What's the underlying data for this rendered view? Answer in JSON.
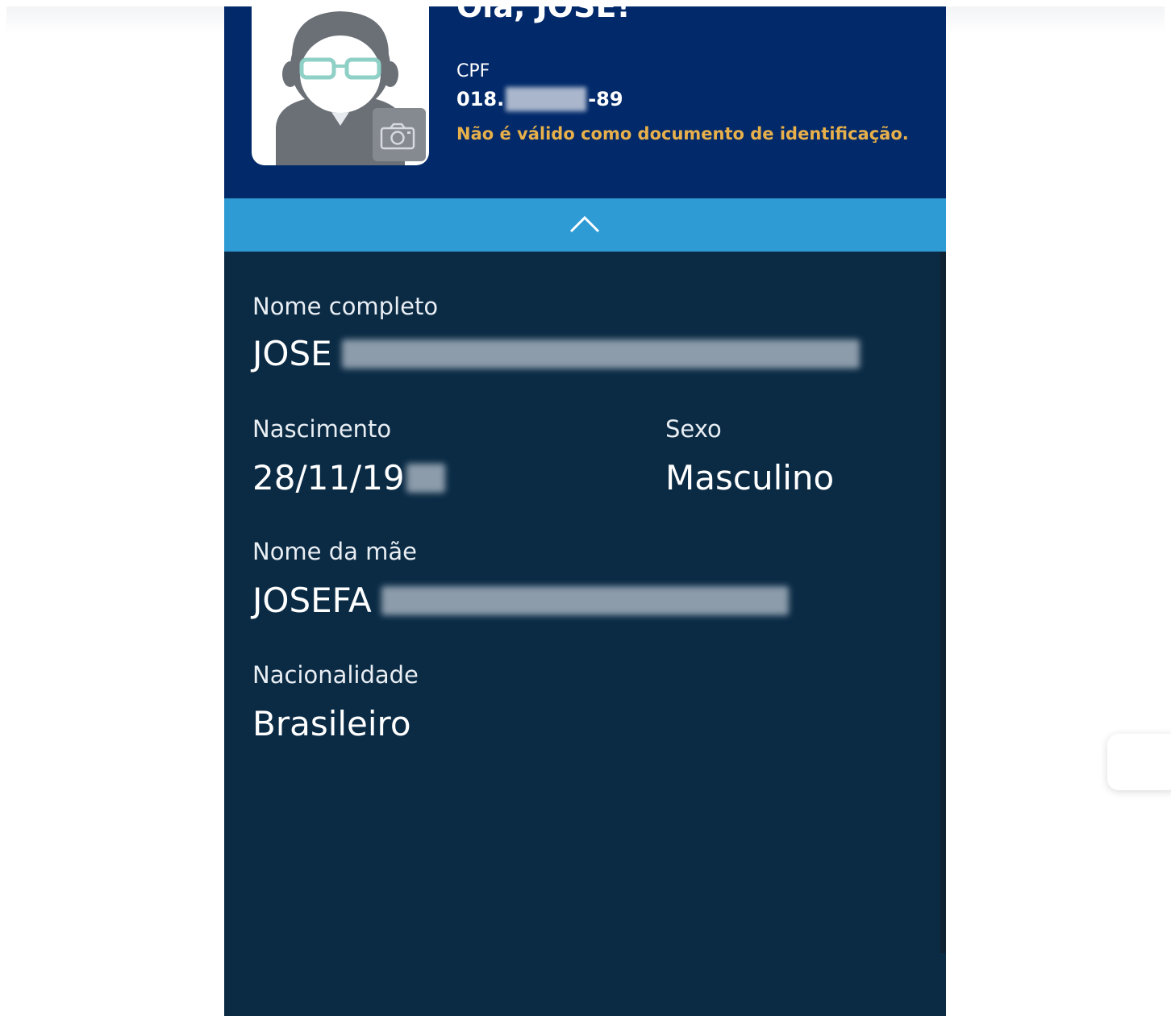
{
  "header": {
    "greeting": "Olá, JOSE!",
    "cpf_label": "CPF",
    "cpf_prefix": "018.",
    "cpf_suffix": "-89",
    "warning": "Não é válido como documento de identificação."
  },
  "fields": {
    "full_name": {
      "label": "Nome completo",
      "value": "JOSE"
    },
    "birth": {
      "label": "Nascimento",
      "value": "28/11/19"
    },
    "sex": {
      "label": "Sexo",
      "value": "Masculino"
    },
    "mother": {
      "label": "Nome da mãe",
      "value": "JOSEFA"
    },
    "nationality": {
      "label": "Nacionalidade",
      "value": "Brasileiro"
    }
  },
  "colors": {
    "header_bg": "#022a6a",
    "collapse_bar": "#2f9bd4",
    "body_bg": "#0b2b45",
    "warning": "#e8b04a"
  },
  "icons": [
    "avatar-icon",
    "camera-icon",
    "chevron-up-icon"
  ]
}
